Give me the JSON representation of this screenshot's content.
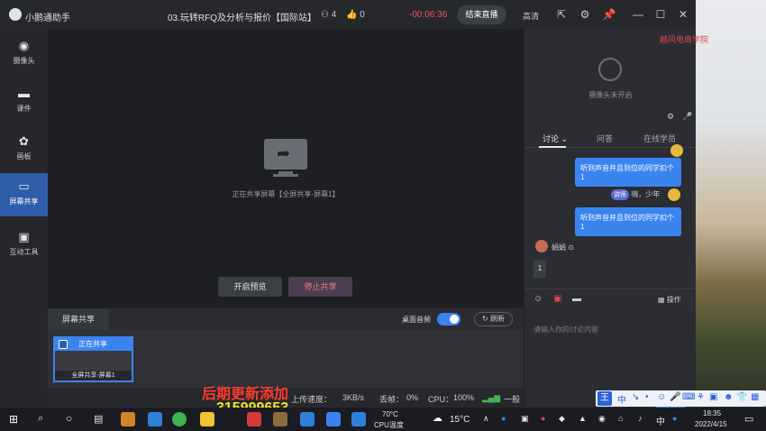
{
  "window": {
    "app_name": "小鹅通助手",
    "course_title": "03.玩转RFQ及分析与报价【国际站】",
    "people_count": "4",
    "like_count": "0",
    "timer": "-00:06:36",
    "end_live": "结束直播",
    "quality": "高清"
  },
  "sidebar": {
    "items": [
      {
        "label": "摄像头",
        "icon": "camera-icon"
      },
      {
        "label": "课件",
        "icon": "folder-icon"
      },
      {
        "label": "画板",
        "icon": "palette-icon"
      },
      {
        "label": "屏幕共享",
        "icon": "screen-share-icon",
        "active": true
      },
      {
        "label": "互动工具",
        "icon": "toolbox-icon"
      }
    ]
  },
  "preview": {
    "sharing_text": "正在共享屏幕【全屏共享-屏幕1】",
    "preview_button": "开启预览",
    "stop_button": "停止共享"
  },
  "share_panel": {
    "tab": "屏幕共享",
    "desktop_audio": "桌面音频",
    "desktop_audio_on": true,
    "refresh": "刷新",
    "thumb_status": "正在共享",
    "thumb_caption": "全屏共享-屏幕1"
  },
  "status_bar": {
    "upload_label": "上传速度：",
    "upload_value": "3KB/s",
    "loss_label": "丢帧：",
    "loss_value": "0%",
    "cpu_label": "CPU：",
    "cpu_value": "100%",
    "signal": "一般"
  },
  "right_panel": {
    "camera_off": "摄像头未开启",
    "tabs": [
      "讨论",
      "问答",
      "在线学员"
    ],
    "messages": [
      {
        "text": "听到声音并且到位的同学扣个1"
      },
      {
        "tag": "讲师",
        "text": "嗨，少年"
      },
      {
        "text": "听到声音并且到位的同学扣个1"
      },
      {
        "user": "娟娟"
      },
      {
        "text": "1"
      }
    ],
    "operation": "操作",
    "input_placeholder": "请输入你的讨论内容",
    "send": "发送"
  },
  "overlay": {
    "watermark": "越风电商学院",
    "promo_line1": "后期更新添加",
    "promo_line2": "315999653"
  },
  "ime": {
    "badge": "王",
    "mode": "中"
  },
  "taskbar": {
    "temp": "70°C",
    "cpu_temp_label": "CPU温度",
    "weather": "15°C",
    "lang": "中",
    "time": "18:35",
    "date": "2022/4/15"
  }
}
